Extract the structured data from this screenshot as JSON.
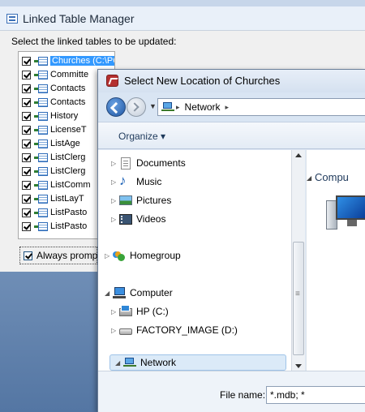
{
  "linked_table_manager": {
    "title": "Linked Table Manager",
    "instruction": "Select the linked tables to be updated:",
    "tables": [
      {
        "label": "Churches   (C:\\POMA\\POMA Data\\POMA Application.mdb)",
        "checked": true,
        "selected": true
      },
      {
        "label": "Committe",
        "checked": true,
        "selected": false
      },
      {
        "label": "Contacts",
        "checked": true,
        "selected": false
      },
      {
        "label": "Contacts",
        "checked": true,
        "selected": false
      },
      {
        "label": "History",
        "checked": true,
        "selected": false
      },
      {
        "label": "LicenseT",
        "checked": true,
        "selected": false
      },
      {
        "label": "ListAge",
        "checked": true,
        "selected": false
      },
      {
        "label": "ListClerg",
        "checked": true,
        "selected": false
      },
      {
        "label": "ListClerg",
        "checked": true,
        "selected": false
      },
      {
        "label": "ListComm",
        "checked": true,
        "selected": false
      },
      {
        "label": "ListLayT",
        "checked": true,
        "selected": false
      },
      {
        "label": "ListPasto",
        "checked": true,
        "selected": false
      },
      {
        "label": "ListPasto",
        "checked": true,
        "selected": false
      }
    ],
    "always_prompt": {
      "label": "Always promp",
      "checked": true
    }
  },
  "dialog": {
    "title": "Select New Location of Churches",
    "address": {
      "crumb": "Network",
      "sep": "▸",
      "sep2": "▸"
    },
    "toolbar": {
      "organize": "Organize ▾"
    },
    "nav": {
      "documents": "Documents",
      "music": "Music",
      "pictures": "Pictures",
      "videos": "Videos",
      "homegroup": "Homegroup",
      "computer": "Computer",
      "hp_drive": "HP (C:)",
      "factory_drive": "FACTORY_IMAGE (D:)",
      "network": "Network"
    },
    "content": {
      "header": "Compu"
    },
    "filename": {
      "label": "File name:",
      "value": "*.mdb; *"
    }
  }
}
